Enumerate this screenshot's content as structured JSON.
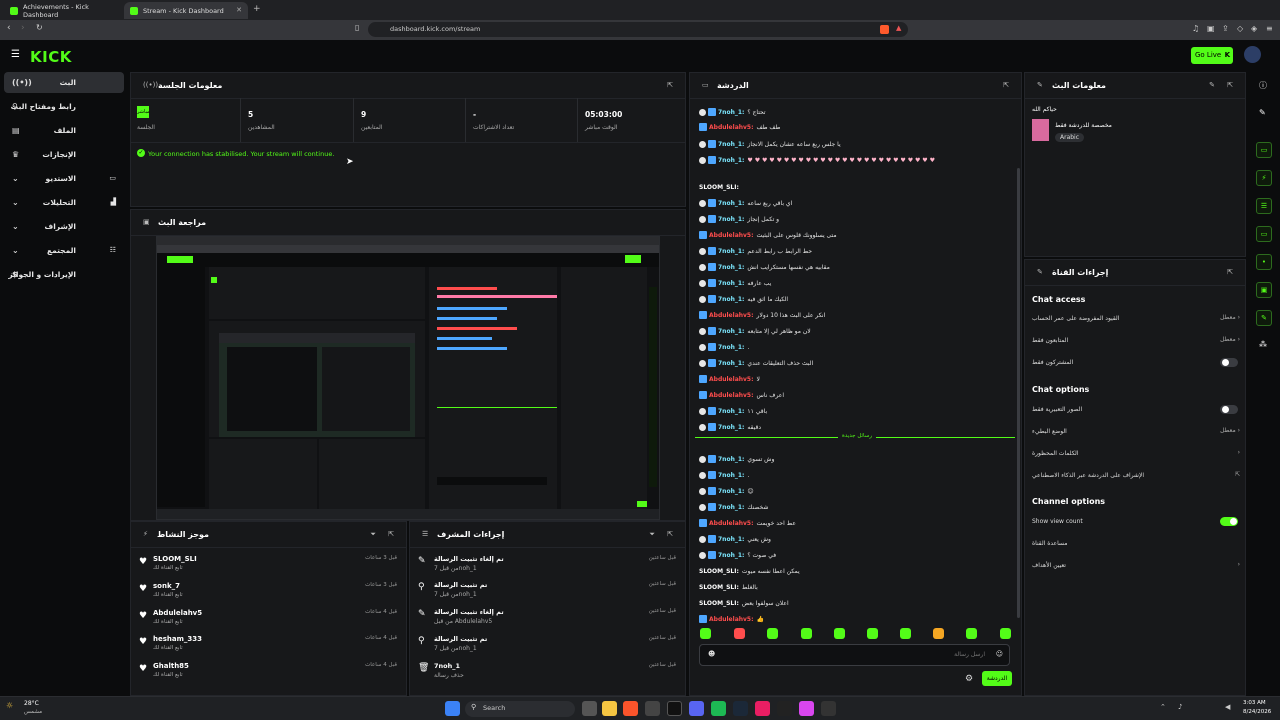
{
  "browser": {
    "tabs": [
      {
        "label": "Achievements - Kick Dashboard"
      },
      {
        "label": "Stream - Kick Dashboard"
      }
    ],
    "url": "dashboard.kick.com/stream"
  },
  "header": {
    "logo": "KICK",
    "go_live": "Go Live"
  },
  "sidebar": {
    "items": [
      {
        "label": "البث"
      },
      {
        "label": "رابط ومفتاح البث"
      },
      {
        "label": "الملف"
      },
      {
        "label": "الإنجازات"
      },
      {
        "label": "الاستديو"
      },
      {
        "label": "التحليلات"
      },
      {
        "label": "الإشراف"
      },
      {
        "label": "المجتمع"
      },
      {
        "label": "الإيرادات و الجوائز"
      }
    ]
  },
  "session": {
    "title": "معلومات الجلسة",
    "badge": "مباشر",
    "live_label": "الجلسة",
    "stats": [
      {
        "value": "5",
        "label": "المشاهدين"
      },
      {
        "value": "9",
        "label": "المتابعين"
      },
      {
        "value": "-",
        "label": "تعداد الاشتراكات"
      },
      {
        "value": "05:03:00",
        "label": "الوقت مباشر"
      }
    ],
    "notice": "Your connection has stabilised. Your stream will continue."
  },
  "preview": {
    "title": "مراجعة البث"
  },
  "chat": {
    "title": "الدردشة",
    "divider": "رسائل جديدة",
    "lines": [
      {
        "user": "7noh_1:",
        "text": "تحتاج ؟",
        "color": "#53fc18"
      },
      {
        "user": "Abdulelahv5:",
        "text": "طف طف",
        "color": "#ff4d4d"
      },
      {
        "user": "7noh_1:",
        "text": "يا جلس ربع ساعه عشان يكمل الانجاز",
        "color": "#53fc18"
      },
      {
        "user": "7noh_1:",
        "text": "♥ ♥ ♥ ♥ ♥ ♥ ♥ ♥ ♥ ♥ ♥ ♥ ♥ ♥ ♥ ♥ ♥ ♥ ♥ ♥ ♥ ♥ ♥ ♥ ♥ ♥",
        "color": "#53fc18"
      },
      {
        "user": "SLOOM_SLI:",
        "text": "",
        "color": "#ffffff"
      },
      {
        "user": "7noh_1:",
        "text": "اي باقي ربع ساعه",
        "color": "#53fc18"
      },
      {
        "user": "7noh_1:",
        "text": "و تكمل إنجاز",
        "color": "#53fc18"
      },
      {
        "user": "Abdulelahv5:",
        "text": "متى يسلوونك قلوس على البثيث",
        "color": "#ff4d4d"
      },
      {
        "user": "7noh_1:",
        "text": "حط الرابط ب رابط الدعم",
        "color": "#53fc18"
      },
      {
        "user": "7noh_1:",
        "text": "مقابيه هي نفسها مستكرايب انش",
        "color": "#53fc18"
      },
      {
        "user": "7noh_1:",
        "text": "يب عارفه",
        "color": "#53fc18"
      },
      {
        "user": "7noh_1:",
        "text": "الكيك ما اثق فيه",
        "color": "#53fc18"
      },
      {
        "user": "Abdulelahv5:",
        "text": "انكر على البث هذا 10 دولار",
        "color": "#ff4d4d"
      },
      {
        "user": "7noh_1:",
        "text": "لان مو ظاهر لي إلا متابعه",
        "color": "#53fc18"
      },
      {
        "user": "7noh_1:",
        "text": ".",
        "color": "#53fc18"
      },
      {
        "user": "7noh_1:",
        "text": "البث حذف التعليقات عندي",
        "color": "#53fc18"
      },
      {
        "user": "Abdulelahv5:",
        "text": "لا",
        "color": "#ff4d4d"
      },
      {
        "user": "Abdulelahv5:",
        "text": "اعرف ناس",
        "color": "#ff4d4d"
      },
      {
        "user": "7noh_1:",
        "text": "باقي ١١",
        "color": "#53fc18"
      },
      {
        "user": "7noh_1:",
        "text": "دقيقه",
        "color": "#53fc18"
      },
      {
        "user": "7noh_1:",
        "text": "وش تسوي",
        "color": "#53fc18"
      },
      {
        "user": "7noh_1:",
        "text": ".",
        "color": "#53fc18"
      },
      {
        "user": "7noh_1:",
        "text": "😊",
        "color": "#53fc18"
      },
      {
        "user": "7noh_1:",
        "text": "شخصنك",
        "color": "#53fc18"
      },
      {
        "user": "Abdulelahv5:",
        "text": "عط احد خويمت",
        "color": "#ff4d4d"
      },
      {
        "user": "7noh_1:",
        "text": "وش يعني",
        "color": "#53fc18"
      },
      {
        "user": "7noh_1:",
        "text": "في صوت ؟",
        "color": "#53fc18"
      },
      {
        "user": "SLOOM_SLI:",
        "text": "يمكن اعطا نفسه ميوت",
        "color": "#ffffff"
      },
      {
        "user": "SLOOM_SLI:",
        "text": "بالغلط",
        "color": "#ffffff"
      },
      {
        "user": "SLOOM_SLI:",
        "text": "اعلان سولفوا بعض",
        "color": "#ffffff"
      },
      {
        "user": "Abdulelahv5:",
        "text": "👍",
        "color": "#ff4d4d"
      }
    ],
    "input_placeholder": "ارسل رسالة",
    "send_label": "الدردشة"
  },
  "activity": {
    "title": "موجز النشاط",
    "items": [
      {
        "name": "SLOOM_SLI",
        "sub": "تابع القناة لك",
        "time": "قبل 3 ساعات"
      },
      {
        "name": "sonk_7",
        "sub": "تابع القناة لك",
        "time": "قبل 3 ساعات"
      },
      {
        "name": "Abdulelahv5",
        "sub": "تابع القناة لك",
        "time": "قبل 4 ساعات"
      },
      {
        "name": "hesham_333",
        "sub": "تابع القناة لك",
        "time": "قبل 4 ساعات"
      },
      {
        "name": "Ghalth85",
        "sub": "تابع القناة لك",
        "time": "قبل 4 ساعات"
      }
    ]
  },
  "modactions": {
    "title": "إجراءات المشرف",
    "items": [
      {
        "name": "تم إلغاء تثبيت الرسالة",
        "sub": "من قبل 7noh_1",
        "time": "قبل ساعتين"
      },
      {
        "name": "تم تثبيت الرسالة",
        "sub": "من قبل 7noh_1",
        "time": "قبل ساعتين"
      },
      {
        "name": "تم إلغاء تثبيت الرسالة",
        "sub": "من قبل Abdulelahv5",
        "time": "قبل ساعتين"
      },
      {
        "name": "تم تثبيت الرسالة",
        "sub": "من قبل 7noh_1",
        "time": "قبل ساعتين"
      },
      {
        "name": "7noh_1",
        "sub": "حذف رسالة",
        "time": "قبل ساعتين"
      }
    ]
  },
  "streaminfo": {
    "title": "معلومات البث",
    "name": "حياكم الله",
    "category": "مخصصة للدردشة فقط",
    "language": "Arabic"
  },
  "channelactions": {
    "title": "إجراءات القناة",
    "chat_access": "Chat access",
    "chat_options": "Chat options",
    "channel_options": "Channel options",
    "rows": [
      {
        "label": "القيود المفروضة على عمر الحساب",
        "value": "معطل"
      },
      {
        "label": "المتابعون فقط",
        "value": "معطل"
      },
      {
        "label": "المشتركون فقط",
        "value": ""
      },
      {
        "label": "الصور التعبيرية فقط",
        "value": ""
      },
      {
        "label": "الوضع البطيء",
        "value": "معطل"
      },
      {
        "label": "الكلمات المحظورة",
        "value": ""
      },
      {
        "label": "الإشراف على الدردشة عبر الذكاء الاصطناعي",
        "value": ""
      },
      {
        "label": "Show view count",
        "value": ""
      },
      {
        "label": "مساعدة القناة",
        "value": ""
      },
      {
        "label": "تعيين الأهداف",
        "value": ""
      }
    ]
  },
  "taskbar": {
    "weather": "28°C",
    "weather_sub": "مشمس",
    "search": "Search",
    "time": "3:03 AM",
    "date": "8/24/2026"
  },
  "colors": {
    "accent": "#53fc18",
    "panel": "#17181a"
  }
}
